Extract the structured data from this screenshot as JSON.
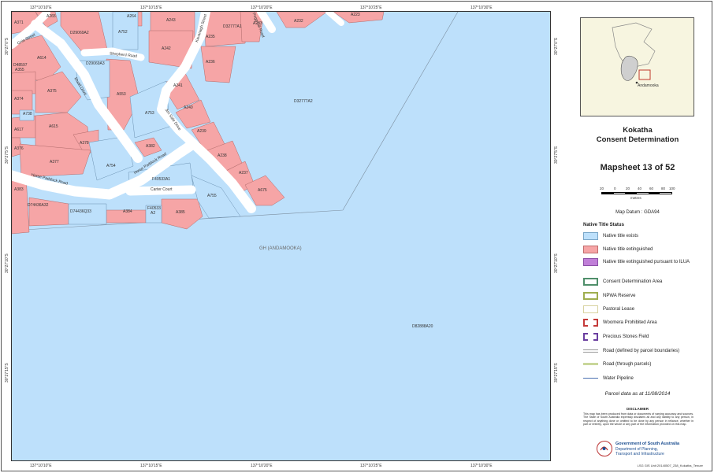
{
  "map": {
    "top_ticks": [
      "137°10'10\"E",
      "137°10'15\"E",
      "137°10'20\"E",
      "137°10'25\"E",
      "137°10'30\"E"
    ],
    "bottom_ticks": [
      "137°10'10\"E",
      "137°10'15\"E",
      "137°10'20\"E",
      "137°10'25\"E",
      "137°10'30\"E"
    ],
    "side_ticks": [
      "30°27'0\"S",
      "30°27'5\"S",
      "30°27'10\"S",
      "30°27'15\"S",
      "30°27'20\"S"
    ],
    "streets": {
      "gnis": "Gnis Street",
      "shepherd": "Shepherd Road",
      "kavanagh": "Kavanagh Street",
      "pegg": "Pegg Hill Road",
      "mudd": "Mudd Drive",
      "jim_sale": "Jim Sale Drive",
      "horse_paddock": "Horse Paddock Road",
      "horse_paddock_w": "Horse Paddock Road",
      "carter": "Carter Court"
    },
    "parcels": {
      "A371": "A371",
      "A265": "A265",
      "A264": "A264",
      "A243": "A243",
      "A223": "A223",
      "D29069A2": "D29069A2",
      "A752": "A752",
      "A242": "A242",
      "A235": "A235",
      "D32777A1": "D32777A1",
      "A233": "A233",
      "A232": "A232",
      "D29069A3": "D29069A3",
      "A236": "A236",
      "A614": "A614",
      "D48597": "D48597",
      "A355": "A355",
      "A374": "A374",
      "A375": "A375",
      "A553": "A553",
      "A241": "A241",
      "D32777A2": "D32777A2",
      "A738": "A738",
      "A240": "A240",
      "A753": "A753",
      "A617": "A617",
      "A615": "A615",
      "A239": "A239",
      "A378": "A378",
      "A376": "A376",
      "A382": "A382",
      "A238": "A238",
      "A377": "A377",
      "A754": "A754",
      "F40533A1": "F40533A1",
      "A237": "A237",
      "A383": "A383",
      "A675": "A675",
      "A755": "A755",
      "D74436A32": "D74436A32",
      "D74436Q33": "D74436Q33",
      "A384": "A384",
      "F40533": "F40533",
      "A2": "A2",
      "A385": "A385",
      "GH": "GH (ANDAMOOKA)",
      "D82888A20": "D82888A20"
    }
  },
  "inset": {
    "label": "Andamooka"
  },
  "title": {
    "line1": "Kokatha",
    "line2": "Consent Determination"
  },
  "mapsheet": "Mapsheet 13 of 52",
  "scale": {
    "ticks": [
      "20",
      "0",
      "20",
      "40",
      "60",
      "80",
      "100"
    ],
    "unit": "metres"
  },
  "datum": "Map Datum : GDA94",
  "legend": {
    "title": "Native Title Status",
    "items": [
      {
        "label": "Native title exists",
        "color": "#bde0fb",
        "border": "#7aa6c8"
      },
      {
        "label": "Native title extinguished",
        "color": "#f6a5a6",
        "border": "#c06c6c"
      },
      {
        "label": "Native title extinguished pursuant to ILUA",
        "color": "#c07fd8",
        "border": "#8c4fa8"
      },
      {
        "label": "Consent Determination Area",
        "color": "#ffffff",
        "border": "#4f8f6a"
      },
      {
        "label": "NPWA Reserve",
        "color": "#ffffff",
        "border": "#9fae4f"
      },
      {
        "label": "Pastoral Lease",
        "color": "#ffffff",
        "border": "#d8d2a0"
      },
      {
        "label": "Woomera Prohibited Area",
        "color": "#ffffff",
        "border": "#c43a3a"
      },
      {
        "label": "Precious Stones Field",
        "color": "#ffffff",
        "border": "#6b3fa0"
      },
      {
        "label": "Road (defined by parcel boundaries)",
        "color": "#9a9a9a",
        "border": "#9a9a9a"
      },
      {
        "label": "Road (through parcels)",
        "color": "#c9d79a",
        "border": "#c9d79a"
      },
      {
        "label": "Water Pipeline",
        "color": "#4a6fb0",
        "border": "#4a6fb0"
      }
    ]
  },
  "parcel_date": "Parcel data as at 11/08/2014",
  "disclaimer": {
    "title": "DISCLAIMER",
    "text": "This map has been produced from data or documents of varying accuracy and sources. The State of South Australia expressly disclaims all and any liability to any person, in respect of anything done or omitted to be done by any person in reliance, whether in part or entirely, upon the whole or any part of the information provided on this map."
  },
  "gov": {
    "line1": "Government of South Australia",
    "line2": "Department of Planning,",
    "line3": "Transport and Infrastructure"
  },
  "footer": "LSG GIS Unit  20140507_238_Kokatha_Tenure"
}
